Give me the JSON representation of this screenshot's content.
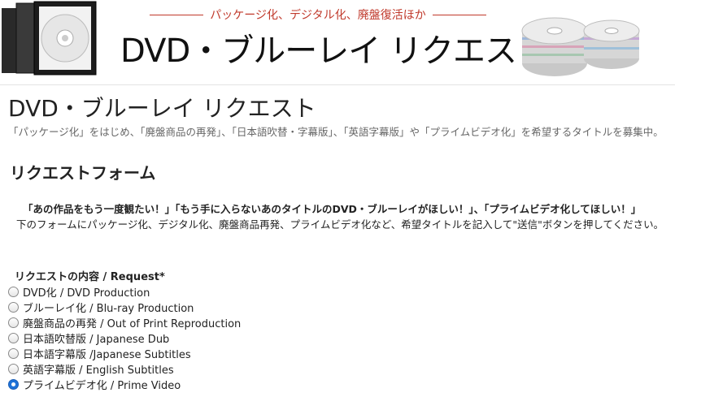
{
  "banner": {
    "tagline": "パッケージ化、デジタル化、廃盤復活ほか",
    "title": "DVD・ブルーレイ リクエスト"
  },
  "page": {
    "title": "DVD・ブルーレイ リクエスト",
    "intro": "「パッケージ化」をはじめ、「廃盤商品の再発」、「日本語吹替・字幕版」、「英語字幕版」や「プライムビデオ化」を希望するタイトルを募集中。"
  },
  "form": {
    "title": "リクエストフォーム",
    "lead_bold": "「あの作品をもう一度観たい！」「もう手に入らないあのタイトルのDVD・ブルーレイがほしい！」、「プライムビデオ化してほしい！」",
    "lead_text": "下のフォームにパッケージ化、デジタル化、廃盤商品再発、プライムビデオ化など、希望タイトルを記入して\"送信\"ボタンを押してください。",
    "request_label": "リクエストの内容 / Request*",
    "options": [
      {
        "label": "DVD化 / DVD Production",
        "checked": false
      },
      {
        "label": "ブルーレイ化 / Blu-ray Production",
        "checked": false
      },
      {
        "label": "廃盤商品の再発 / Out of Print Reproduction",
        "checked": false
      },
      {
        "label": "日本語吹替版 / Japanese Dub",
        "checked": false
      },
      {
        "label": "日本語字幕版 /Japanese Subtitles",
        "checked": false
      },
      {
        "label": "英語字幕版 / English Subtitles",
        "checked": false
      },
      {
        "label": "プライムビデオ化 / Prime Video",
        "checked": true
      }
    ]
  },
  "colors": {
    "tagline": "#c0392b",
    "radio_selected": "#1e72d8",
    "intro_text": "#666666"
  }
}
